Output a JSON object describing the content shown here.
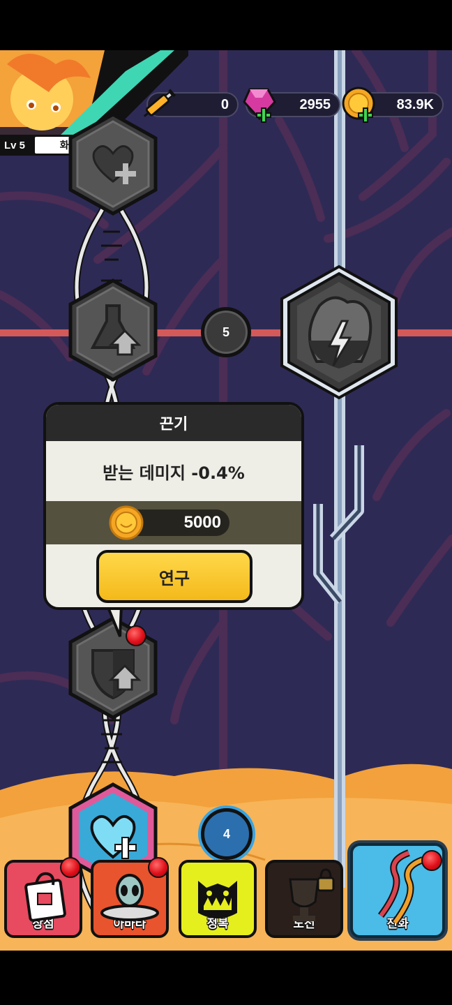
{
  "player": {
    "level": "Lv 5",
    "title": "화성탈출자"
  },
  "resources": {
    "syringe": "0",
    "gems": "2955",
    "coins": "83.9K"
  },
  "nodes": {
    "connector_count_upper": "5",
    "connector_count_lower": "4"
  },
  "popup": {
    "title": "끈기",
    "description": "받는 데미지 -0.4%",
    "cost": "5000",
    "button": "연구"
  },
  "nav": [
    {
      "label": "상점",
      "badge": true
    },
    {
      "label": "아바타",
      "badge": true
    },
    {
      "label": "정복",
      "badge": false
    },
    {
      "label": "도전",
      "locked": true
    },
    {
      "label": "진화",
      "badge": true,
      "active": true
    }
  ],
  "colors": {
    "background": "#2e2a56",
    "sand": "#f6a94a",
    "accent_yellow": "#ffd84a",
    "active_tab": "#4bbbe8"
  }
}
